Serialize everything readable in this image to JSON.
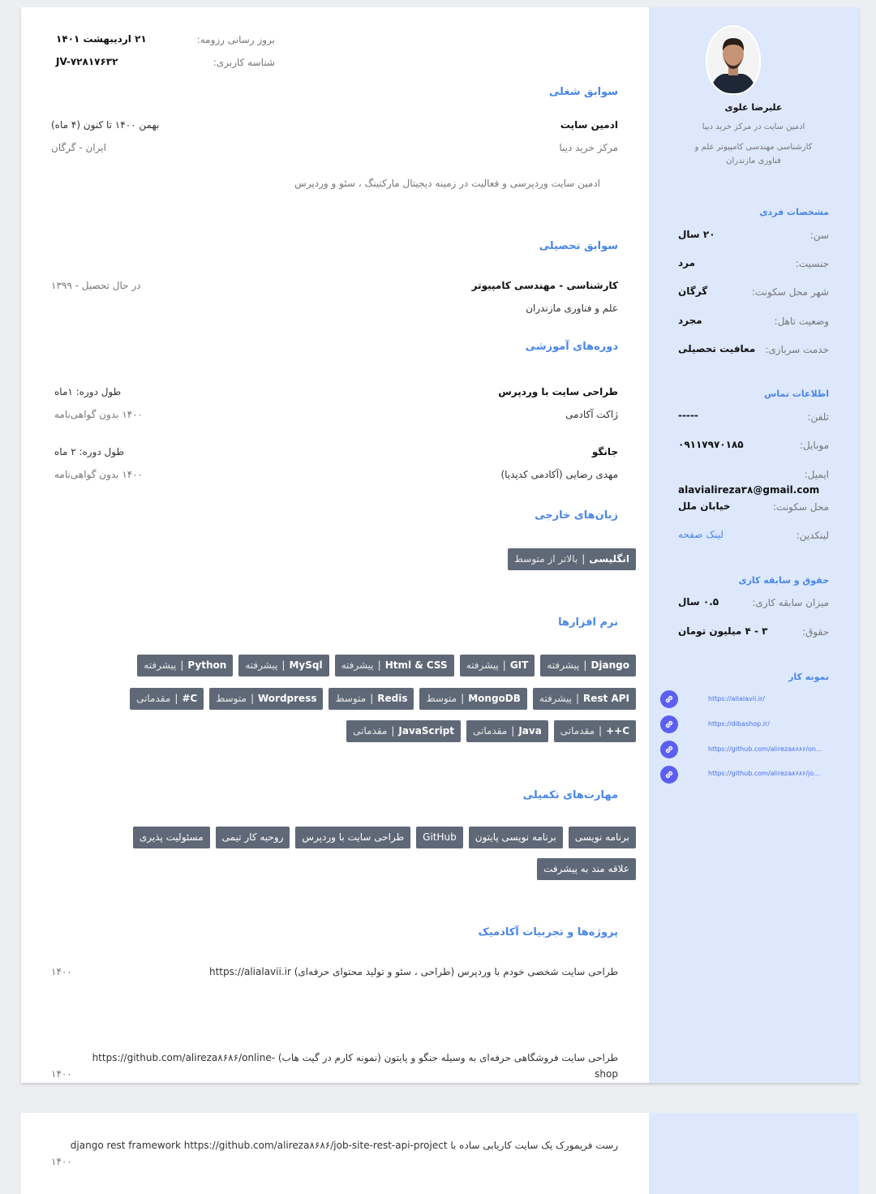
{
  "meta": {
    "update_label": "بروز رسانی رزومه:",
    "update_value": "۲۱ اردیبهشت ۱۴۰۱",
    "id_label": "شناسه کاربری:",
    "id_value": "JV-۷۲۸۱۷۶۳۲"
  },
  "profile": {
    "name": "علیرضا علوی",
    "title": "ادمین سایت در مرکز خرید دیبا",
    "degree_line1": "کارشناسی مهندسی کامپیوتر علم و",
    "degree_line2": "فناوری مازندران"
  },
  "personal": {
    "heading": "مشخصات فردی",
    "rows": [
      {
        "label": "سن:",
        "value": "۲۰ سال"
      },
      {
        "label": "جنسیت:",
        "value": "مرد"
      },
      {
        "label": "شهر محل سکونت:",
        "value": "گرگان"
      },
      {
        "label": "وضعیت تاهل:",
        "value": "مجرد"
      },
      {
        "label": "خدمت سربازی:",
        "value": "معافیت تحصیلی"
      }
    ]
  },
  "contact": {
    "heading": "اطلاعات تماس",
    "phone_label": "تلفن:",
    "phone_value": "-----",
    "mobile_label": "موبایل:",
    "mobile_value": "۰۹۱۱۷۹۷۰۱۸۵",
    "email_label": "ایمیل:",
    "email_value": "alavialireza۳۸@gmail.com",
    "address_label": "محل سکونت:",
    "address_value": "خیابان ملل",
    "linkedin_label": "لینکدین:",
    "linkedin_value": "لینک صفحه"
  },
  "salary": {
    "heading": "حقوق و سابقه کاری",
    "exp_label": "میزان سابقه کاری:",
    "exp_value": "۰.۵ سال",
    "salary_label": "حقوق:",
    "salary_value": "۳ - ۴ میلیون تومان"
  },
  "portfolio": {
    "heading": "نمونه کار",
    "links": [
      "https://alialavii.ir/",
      "https://dibashop.ir/",
      "https://github.com/alireza۸۶۸۶/on...",
      "https://github.com/alireza۸۶۸۶/jo..."
    ]
  },
  "jobs": {
    "heading": "سوابق شغلی",
    "title": "ادمین سایت",
    "date": "بهمن ۱۴۰۰ تا کنون (۴ ماه)",
    "company": "مرکز خرید دیبا",
    "location": "ایران - گرگان",
    "desc": "ادمین سایت وردپرسی و فعالیت در زمینه دیجیتال مارکتینگ ، سئو و وردپرس"
  },
  "education": {
    "heading": "سوابق تحصیلی",
    "degree": "کارشناسی - مهندسی کامپیوتر",
    "status": "در حال تحصیل - ۱۳۹۹",
    "university": "علم و فناوری مازندران"
  },
  "courses": {
    "heading": "دوره‌های آموزشی",
    "items": [
      {
        "title": "طراحی سایت با وردپرس",
        "duration": "طول دوره: ۱ماه",
        "org": "ژاکت آکادمی",
        "cert": "۱۴۰۰ بدون گواهی‌نامه"
      },
      {
        "title": "جانگو",
        "duration": "طول دوره: ۲ ماه",
        "org": "مهدی رضایی (آکادمی کدپدیا)",
        "cert": "۱۴۰۰ بدون گواهی‌نامه"
      }
    ]
  },
  "languages": {
    "heading": "زبان‌های خارجی",
    "items": [
      {
        "name": "انگلیسی",
        "sep": "|",
        "level": "بالاتر از متوسط"
      }
    ]
  },
  "software": {
    "heading": "نرم افزارها",
    "rows": [
      [
        {
          "name": "Django",
          "level": "پیشرفته"
        },
        {
          "name": "GIT",
          "level": "پیشرفته"
        },
        {
          "name": "Html & CSS",
          "level": "پیشرفته"
        },
        {
          "name": "MySql",
          "level": "پیشرفته"
        },
        {
          "name": "Python",
          "level": "پیشرفته"
        }
      ],
      [
        {
          "name": "Rest API",
          "level": "پیشرفته"
        },
        {
          "name": "MongoDB",
          "level": "متوسط"
        },
        {
          "name": "Redis",
          "level": "متوسط"
        },
        {
          "name": "Wordpress",
          "level": "متوسط"
        },
        {
          "name": "#C",
          "level": "مقدماتی"
        }
      ],
      [
        {
          "name": "++C",
          "level": "مقدماتی"
        },
        {
          "name": "Java",
          "level": "مقدماتی"
        },
        {
          "name": "JavaScript",
          "level": "مقدماتی"
        }
      ]
    ],
    "sep": "|"
  },
  "skills": {
    "heading": "مهارت‌های تکمیلی",
    "rows": [
      [
        "برنامه نویسی",
        "برنامه نویسی پایتون",
        "GitHub",
        "طراحی سایت با وردپرس",
        "روحیه کار تیمی",
        "مسئولیت پذیری"
      ],
      [
        "علاقه مند به پیشرفت"
      ]
    ]
  },
  "projects": {
    "heading": "پروژه‌ها و تجربیات آکادمیک",
    "items": [
      {
        "text": "طراحی سایت شخصی خودم با وردپرس (طراحی ، سئو و تولید محتوای حرفه‌ای) https://alialavii.ir",
        "year": "۱۴۰۰"
      },
      {
        "line1": "طراحی سایت فروشگاهی حرفه‌ای به وسیله جنگو و پایتون (نمونه کارم در گیت هاب) -https://github.com/alireza۸۶۸۶/online",
        "line2": "shop",
        "year": "۱۴۰۰"
      },
      {
        "text": "رست فریمورک یک سایت کاریابی ساده با django rest framework https://github.com/alireza۸۶۸۶/job-site-rest-api-project",
        "year": "۱۴۰۰"
      }
    ]
  }
}
